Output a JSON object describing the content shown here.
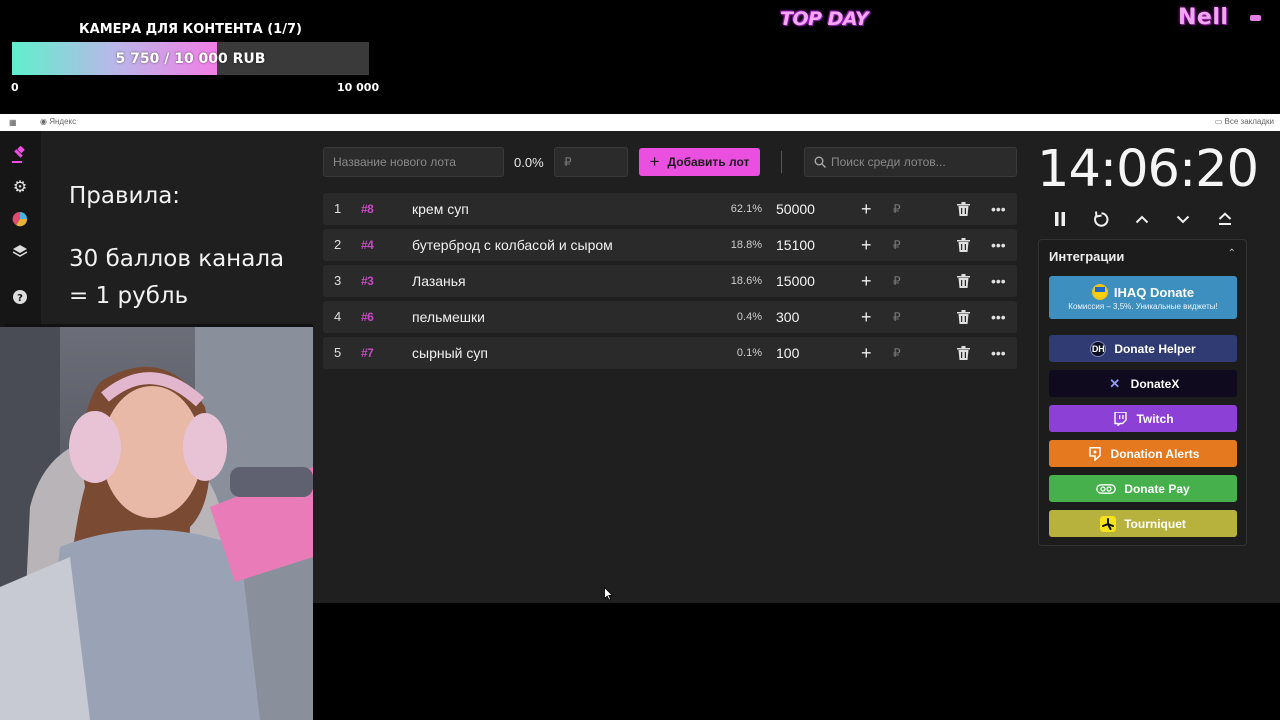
{
  "overlay": {
    "goal_title": "КАМЕРА ДЛЯ КОНТЕНТА (1/7)",
    "goal_text": "5 750 / 10 000 RUB",
    "goal_progress": 0.575,
    "goal_min": "0",
    "goal_max": "10 000",
    "top_day": "TOP DAY",
    "brand": "Nell"
  },
  "browser": {
    "bookmark_yandex": "Яндекс",
    "bookmark_all": "Все закладки"
  },
  "rules": {
    "title": "Правила:",
    "line": "30 баллов канала = 1 рубль"
  },
  "toolbar": {
    "lot_name_placeholder": "Название нового лота",
    "percent": "0.0%",
    "amount_placeholder": "₽",
    "add_label": "Добавить лот",
    "search_placeholder": "Поиск среди лотов..."
  },
  "lots": [
    {
      "num": "1",
      "id": "#8",
      "name": "крем суп",
      "pct": "62.1%",
      "amount": "50000"
    },
    {
      "num": "2",
      "id": "#4",
      "name": "бутерброд с колбасой и сыром",
      "pct": "18.8%",
      "amount": "15100"
    },
    {
      "num": "3",
      "id": "#3",
      "name": "Лазанья",
      "pct": "18.6%",
      "amount": "15000"
    },
    {
      "num": "4",
      "id": "#6",
      "name": "пельмешки",
      "pct": "0.4%",
      "amount": "300"
    },
    {
      "num": "5",
      "id": "#7",
      "name": "сырный суп",
      "pct": "0.1%",
      "amount": "100"
    }
  ],
  "lot_currency": "₽",
  "timer": {
    "value": "14:06:20"
  },
  "integrations": {
    "title": "Интеграции",
    "iahq_label": "IHAQ Donate",
    "iahq_sub": "Комиссия – 3,5%. Уникальные виджеты!",
    "donate_helper": "Donate Helper",
    "donatex": "DonateX",
    "twitch": "Twitch",
    "donation_alerts": "Donation Alerts",
    "donate_pay": "Donate Pay",
    "tourniquet": "Tourniquet"
  },
  "colors": {
    "accent": "#ea4fe0",
    "iahq": "#3d8fc0",
    "donate_helper": "#2f3b72",
    "donatex": "#0f0a1e",
    "twitch": "#8c40d6",
    "donation_alerts": "#e5791f",
    "donate_pay": "#46b04c",
    "tourniquet": "#b7b13e"
  }
}
